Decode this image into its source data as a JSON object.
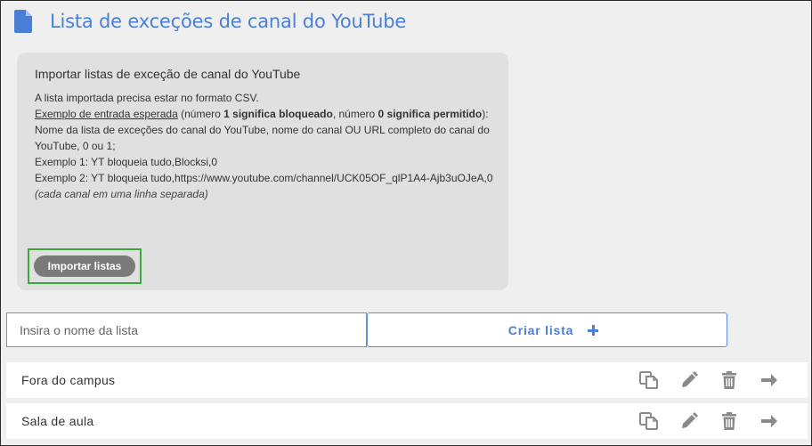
{
  "header": {
    "title": "Lista de exceções de canal do YouTube",
    "icon": "document-icon"
  },
  "import": {
    "title": "Importar listas de exceção de canal do YouTube",
    "line1": "A lista importada precisa estar no formato CSV.",
    "example_link": "Exemplo de entrada esperada",
    "example_text_1": " (número ",
    "example_bold_1": "1 significa bloqueado",
    "example_text_2": ", número ",
    "example_bold_2": "0 significa permitido",
    "example_text_3": "):",
    "format_line": "Nome da lista de exceções do canal do YouTube, nome do canal OU URL completo do canal do YouTube, 0 ou 1;",
    "example1": "Exemplo 1: YT bloqueia tudo,Blocksi,0",
    "example2": "Exemplo 2: YT bloqueia tudo,https://www.youtube.com/channel/UCK05OF_qlP1A4-Ajb3uOJeA,0",
    "note": "(cada canal em uma linha separada)",
    "button_label": "Importar listas"
  },
  "create": {
    "input_placeholder": "Insira o nome da lista",
    "input_value": "",
    "button_label": "Criar lista"
  },
  "lists": [
    {
      "name": "Fora do campus"
    },
    {
      "name": "Sala de aula"
    }
  ],
  "row_actions": [
    "copy-icon",
    "pencil-icon",
    "trash-icon",
    "arrow-right-icon"
  ],
  "colors": {
    "accent": "#4a7fd8",
    "import_button": "#7a7a7a",
    "highlight_border": "#3aaa3a",
    "icon": "#8a8a8a"
  }
}
